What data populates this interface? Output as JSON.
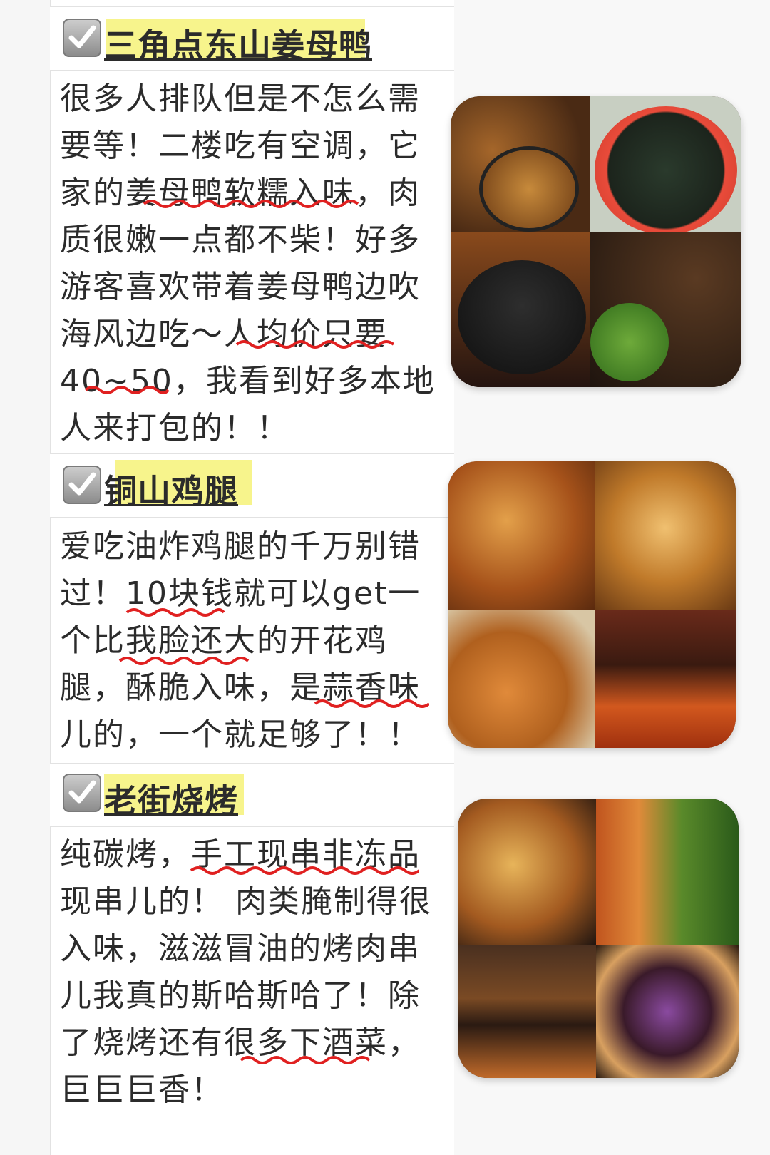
{
  "entries": [
    {
      "title": "三角点东山姜母鸭",
      "lines": [
        "很多人排队但是不怎么需",
        "要等！二楼吃有空调，它",
        "家的姜母鸭软糯入味，肉",
        "质很嫩一点都不柴！好多",
        "游客喜欢带着姜母鸭边吹",
        "海风边吃～人均价只要",
        "40~50，我看到好多本地",
        "人来打包的！！"
      ]
    },
    {
      "title": "铜山鸡腿",
      "lines": [
        "爱吃油炸鸡腿的千万别错",
        "过！10块钱就可以get一",
        "个比我脸还大的开花鸡",
        "腿，酥脆入味，是蒜香味",
        "儿的，一个就足够了！！"
      ]
    },
    {
      "title": "老街烧烤",
      "lines": [
        "纯碳烤，手工现串非冻品",
        "现串儿的！ 肉类腌制得很",
        "入味，滋滋冒油的烤肉串",
        "儿我真的斯哈斯哈了！除",
        "了烧烤还有很多下酒菜，",
        "巨巨巨香！"
      ]
    }
  ],
  "images": [
    {
      "subject": "ginger-duck-dishes-photo"
    },
    {
      "subject": "fried-chicken-leg-photo"
    },
    {
      "subject": "bbq-skewers-photo"
    }
  ],
  "colors": {
    "highlight": "#f7f48c",
    "wavy": "#e02020",
    "check": "#ffffff"
  }
}
